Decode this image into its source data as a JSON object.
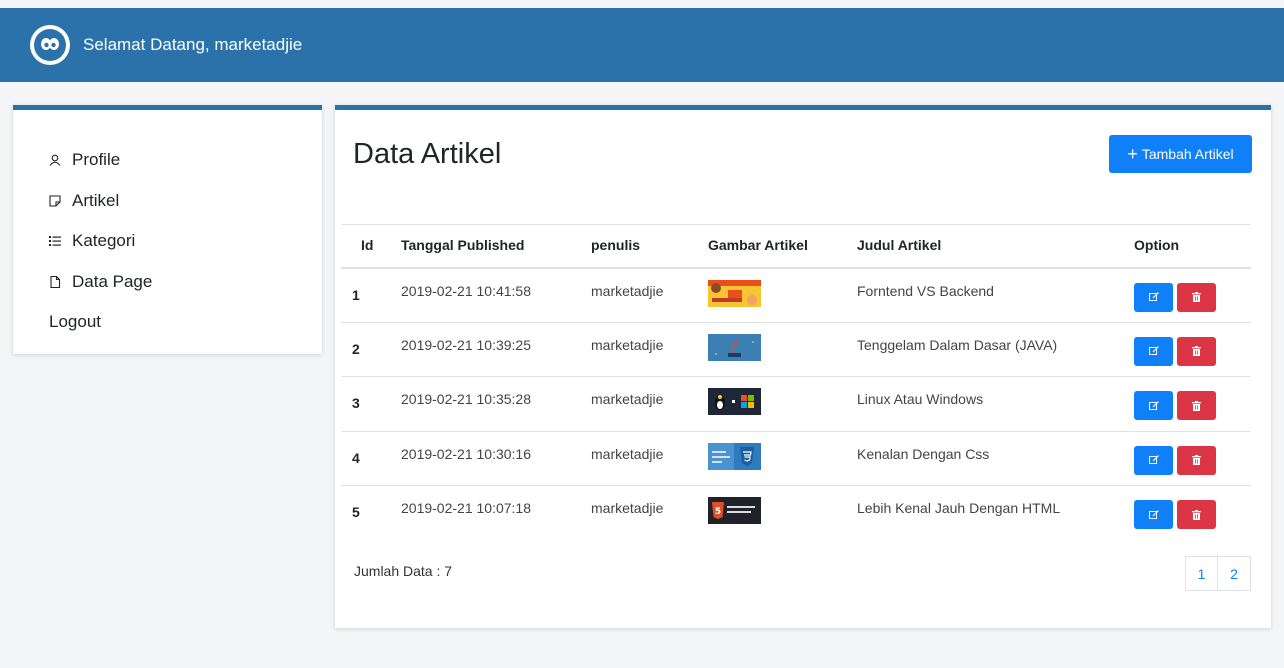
{
  "header": {
    "title": "Selamat Datang, marketadjie"
  },
  "sidebar": {
    "items": [
      {
        "label": "Profile",
        "icon": "user-icon"
      },
      {
        "label": "Artikel",
        "icon": "note-icon"
      },
      {
        "label": "Kategori",
        "icon": "list-icon"
      },
      {
        "label": "Data Page",
        "icon": "file-icon"
      },
      {
        "label": "Logout"
      }
    ]
  },
  "main": {
    "title": "Data Artikel",
    "add_button": "Tambah Artikel",
    "columns": [
      "Id",
      "Tanggal Published",
      "penulis",
      "Gambar Artikel",
      "Judul Artikel",
      "Option"
    ],
    "rows": [
      {
        "id": "1",
        "date": "2019-02-21 10:41:58",
        "author": "marketadjie",
        "thumb": "front-end-back-end-thumbnail",
        "title": "Forntend VS Backend"
      },
      {
        "id": "2",
        "date": "2019-02-21 10:39:25",
        "author": "marketadjie",
        "thumb": "java-thumbnail",
        "title": "Tenggelam Dalam Dasar (JAVA)"
      },
      {
        "id": "3",
        "date": "2019-02-21 10:35:28",
        "author": "marketadjie",
        "thumb": "linux-windows-thumbnail",
        "title": "Linux Atau Windows"
      },
      {
        "id": "4",
        "date": "2019-02-21 10:30:16",
        "author": "marketadjie",
        "thumb": "css-thumbnail",
        "title": "Kenalan Dengan Css"
      },
      {
        "id": "5",
        "date": "2019-02-21 10:07:18",
        "author": "marketadjie",
        "thumb": "html-thumbnail",
        "title": "Lebih Kenal Jauh Dengan HTML"
      }
    ],
    "count_label": "Jumlah Data : 7",
    "pages": [
      "1",
      "2"
    ]
  },
  "colors": {
    "header": "#2a72a9",
    "primary": "#0f80f7",
    "danger": "#dc3545"
  }
}
